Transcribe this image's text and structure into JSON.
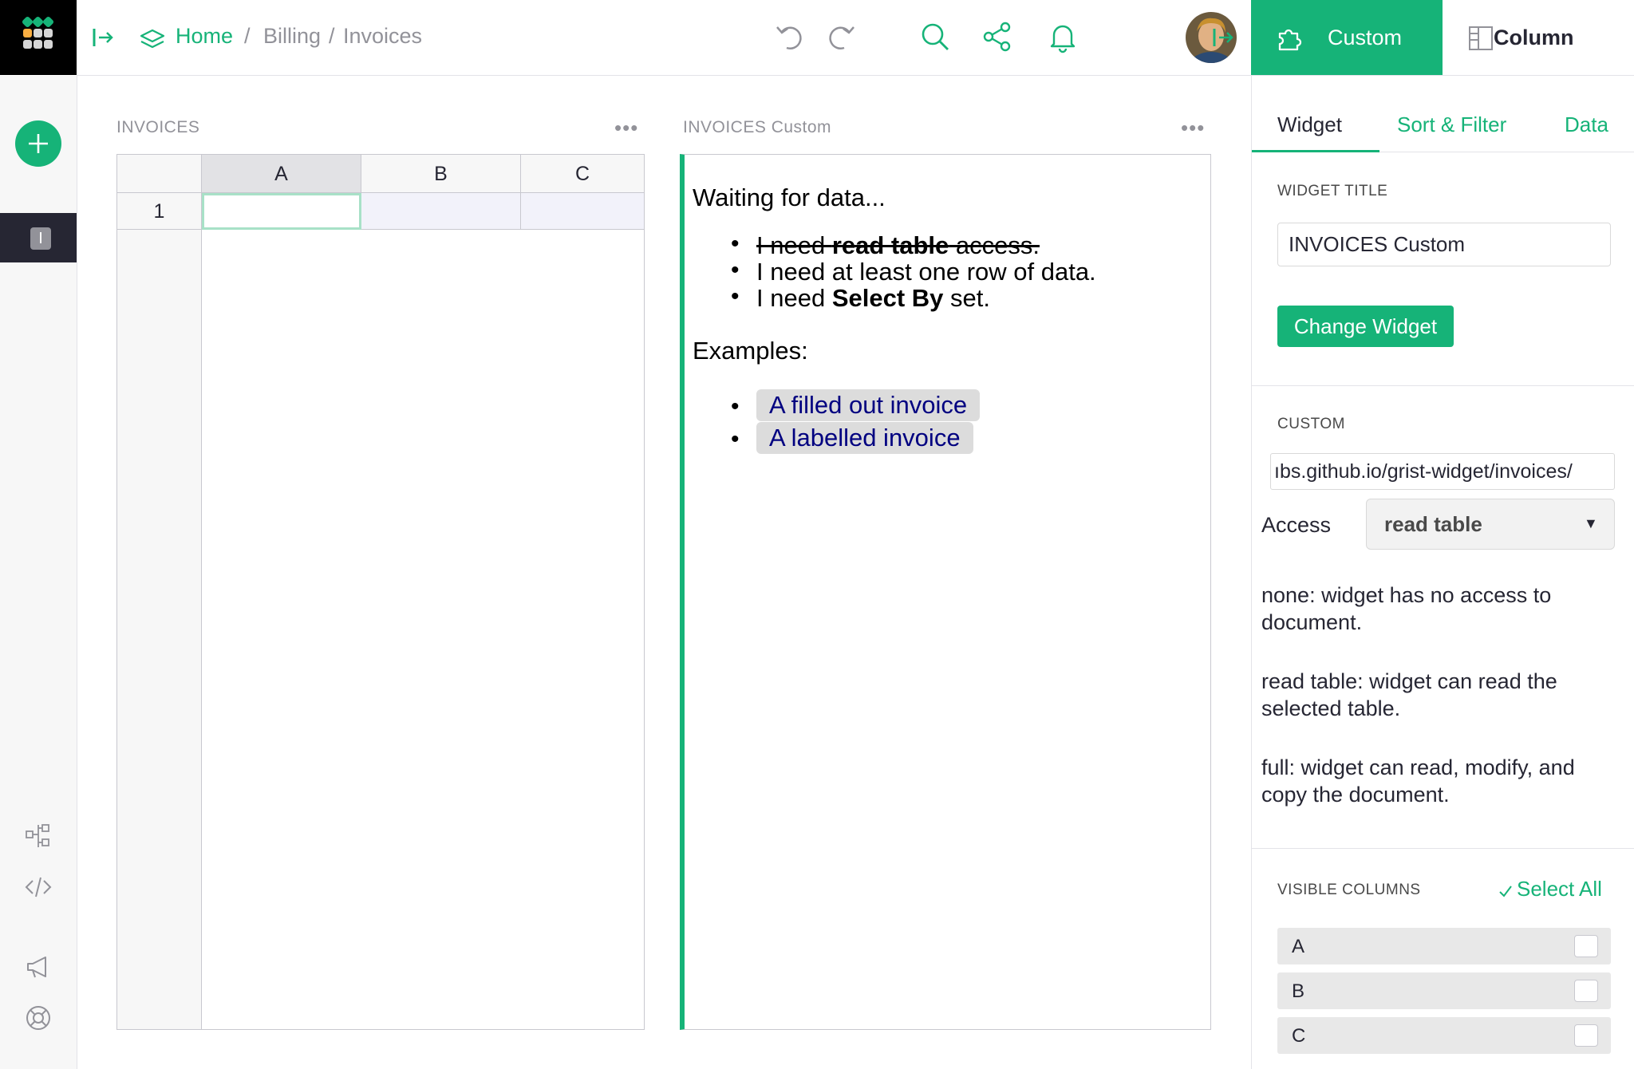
{
  "breadcrumb": {
    "home": "Home",
    "sep": "/",
    "billing": "Billing",
    "invoices": "Invoices"
  },
  "right_tabs": {
    "custom": "Custom",
    "column": "Column"
  },
  "left_rail": {
    "page_initial": "I"
  },
  "grid_section": {
    "title": "INVOICES",
    "more": "•••",
    "columns": [
      "A",
      "B",
      "C"
    ],
    "rows": [
      "1"
    ]
  },
  "custom_section": {
    "title": "INVOICES Custom",
    "more": "•••",
    "waiting": "Waiting for data...",
    "req1_pre": "I need ",
    "req1_bold": "read table",
    "req1_post": " access.",
    "req2": "I need at least one row of data.",
    "req3_pre": "I need ",
    "req3_bold": "Select By",
    "req3_post": " set.",
    "examples_label": "Examples:",
    "examples": [
      "A filled out invoice",
      "A labelled invoice"
    ]
  },
  "right_panel": {
    "sub_tabs": {
      "widget": "Widget",
      "sort_filter": "Sort & Filter",
      "data": "Data"
    },
    "widget_title_label": "WIDGET TITLE",
    "widget_title_value": "INVOICES Custom",
    "change_widget": "Change Widget",
    "custom_label": "CUSTOM",
    "custom_url": "ıbs.github.io/grist-widget/invoices/",
    "access_label": "Access",
    "access_value": "read table",
    "desc_none": "none: widget has no access to document.",
    "desc_read": "read table: widget can read the selected table.",
    "desc_full": "full: widget can read, modify, and copy the document.",
    "visible_columns_label": "VISIBLE COLUMNS",
    "select_all": "Select All",
    "visible_columns": [
      "A",
      "B",
      "C"
    ]
  },
  "colors": {
    "accent": "#16b378",
    "dark": "#262633",
    "muted": "#929299",
    "link_navy": "#000080"
  }
}
